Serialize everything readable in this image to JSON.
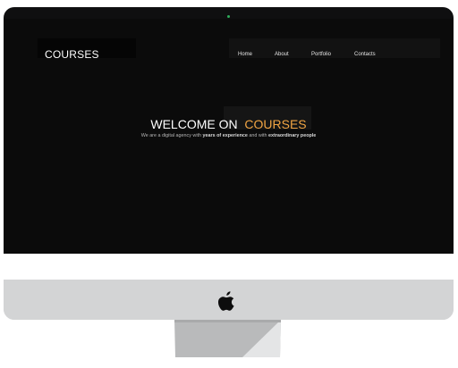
{
  "site": {
    "logo": "COURSES"
  },
  "nav": {
    "items": [
      {
        "label": "Home"
      },
      {
        "label": "About"
      },
      {
        "label": "Portfolio"
      },
      {
        "label": "Contacts"
      }
    ]
  },
  "hero": {
    "title_prefix": "WELCOME ON",
    "title_accent": "COURSES",
    "subtitle_part1": "We are a digital agency with ",
    "subtitle_bold1": "years of experience",
    "subtitle_part2": " and with ",
    "subtitle_bold2": "extraordinary people"
  },
  "colors": {
    "accent": "#f0a443",
    "screen_bg": "#0b0b0b",
    "monitor_body": "#d3d4d5",
    "camera_led": "#2fae5a"
  },
  "icons": {
    "device_logo": "apple-icon"
  }
}
